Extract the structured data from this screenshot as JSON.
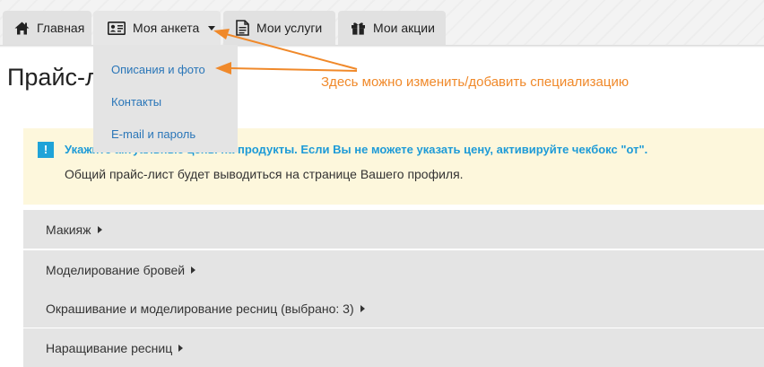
{
  "nav": {
    "tabs": [
      {
        "label": "Главная",
        "icon": "home-icon"
      },
      {
        "label": "Моя анкета",
        "icon": "id-card-icon",
        "active": true
      },
      {
        "label": "Мои услуги",
        "icon": "document-icon"
      },
      {
        "label": "Мои акции",
        "icon": "gift-icon"
      }
    ]
  },
  "page": {
    "title": "Прайс-лист"
  },
  "dropdown": {
    "items": [
      {
        "label": "Описания и фото"
      },
      {
        "label": "Контакты"
      },
      {
        "label": "E-mail и пароль"
      }
    ]
  },
  "annotation": {
    "text": "Здесь можно изменить/добавить специализацию",
    "color": "#f0892a"
  },
  "notice": {
    "icon_glyph": "!",
    "bold_text": "Укажите актуальные цены на продукты. Если Вы не можете указать цену, активируйте чекбокс \"от\".",
    "text": "Общий прайс-лист будет выводиться на странице Вашего профиля."
  },
  "categories": [
    {
      "label": "Макияж"
    },
    {
      "label": "Моделирование бровей"
    },
    {
      "label": "Окрашивание и моделирование ресниц (выбрано: 3)"
    },
    {
      "label": "Наращивание ресниц"
    }
  ],
  "colors": {
    "link": "#2a76b8",
    "accent_blue": "#1e9bd7",
    "notice_bg": "#fdf7dc",
    "panel_bg": "#e4e4e4"
  }
}
